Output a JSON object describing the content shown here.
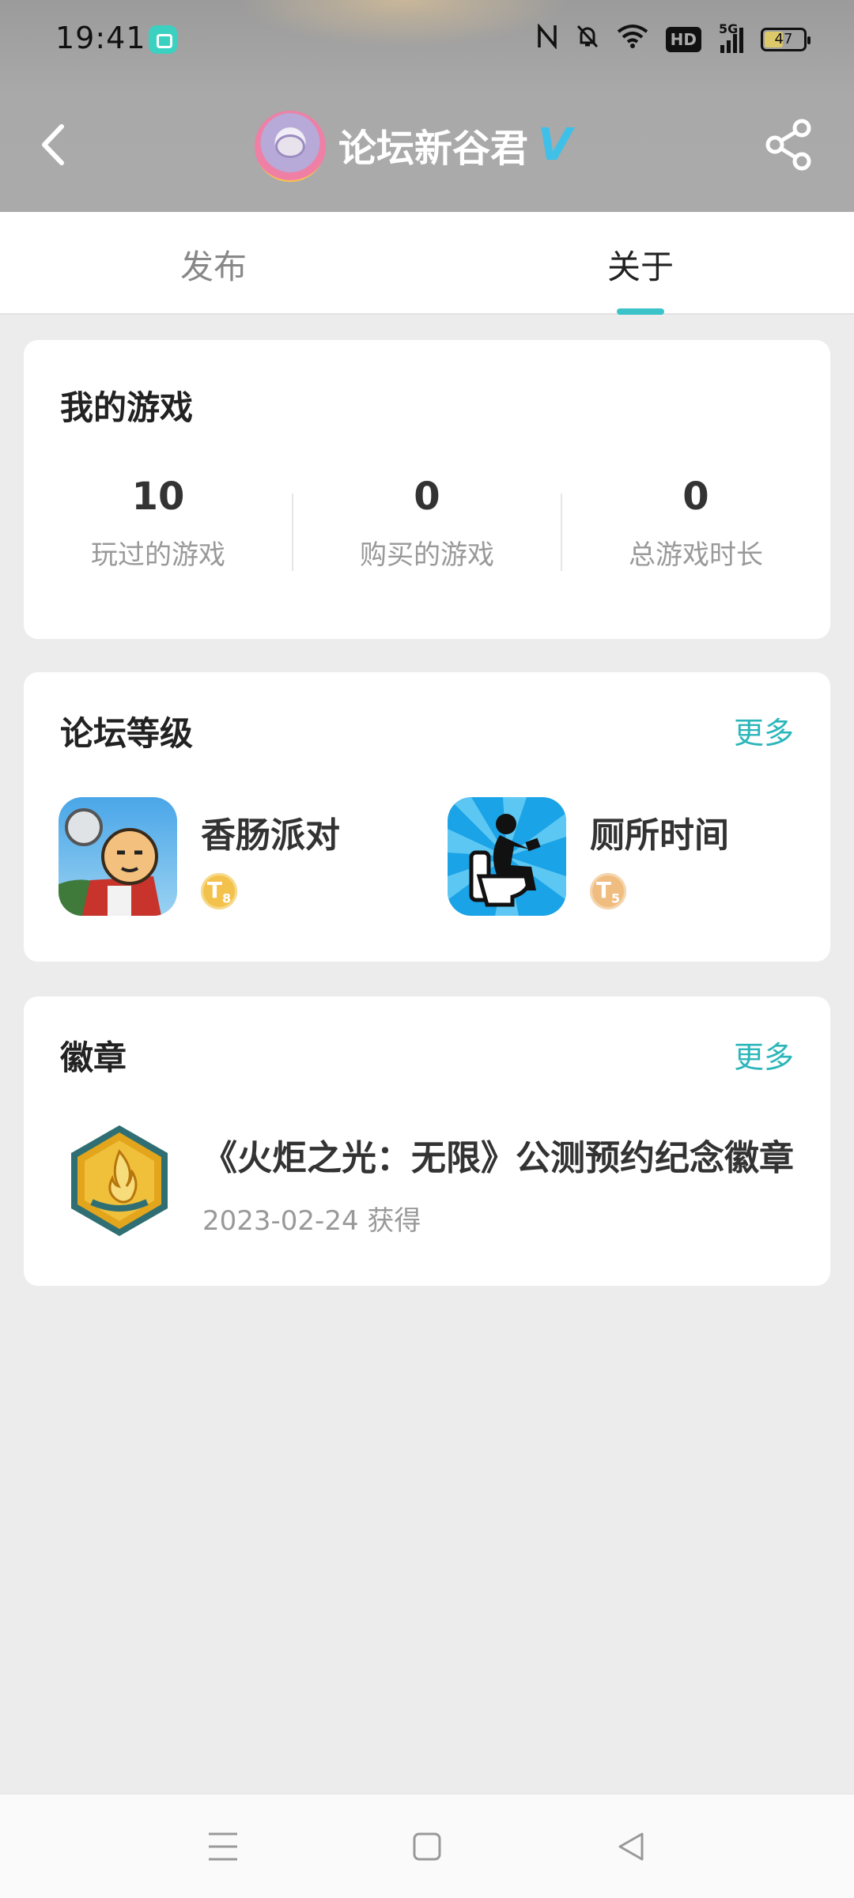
{
  "status_bar": {
    "time": "19:41",
    "hd_label": "HD",
    "network_label": "5G",
    "battery_level": "47"
  },
  "header": {
    "title": "论坛新谷君",
    "verified_mark": "V"
  },
  "tabs": [
    {
      "label": "发布",
      "active": false
    },
    {
      "label": "关于",
      "active": true
    }
  ],
  "my_games": {
    "title": "我的游戏",
    "stats": [
      {
        "value": "10",
        "label": "玩过的游戏"
      },
      {
        "value": "0",
        "label": "购买的游戏"
      },
      {
        "value": "0",
        "label": "总游戏时长"
      }
    ]
  },
  "forum_level": {
    "title": "论坛等级",
    "more_label": "更多",
    "games": [
      {
        "name": "香肠派对",
        "level_letter": "T",
        "level_num": "8",
        "icon": "sausage-party-icon"
      },
      {
        "name": "厕所时间",
        "level_letter": "T",
        "level_num": "5",
        "icon": "toilet-time-icon"
      }
    ]
  },
  "badges": {
    "title": "徽章",
    "more_label": "更多",
    "items": [
      {
        "name": "《火炬之光：无限》公测预约纪念徽章",
        "date": "2023-02-24 获得",
        "icon": "torchlight-badge-icon"
      }
    ]
  },
  "colors": {
    "accent": "#2bb6ba",
    "background": "#ececec",
    "verified": "#3fc0e8"
  }
}
